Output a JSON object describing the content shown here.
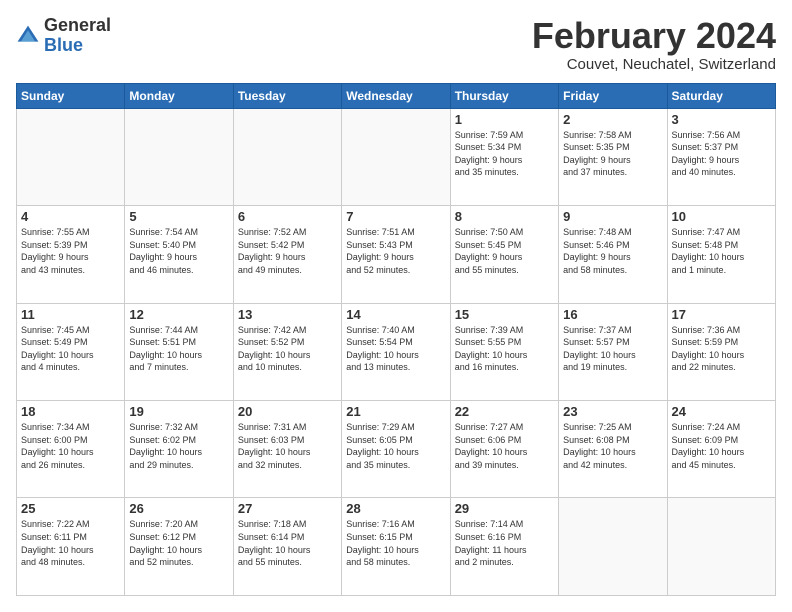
{
  "logo": {
    "general": "General",
    "blue": "Blue"
  },
  "title": "February 2024",
  "location": "Couvet, Neuchatel, Switzerland",
  "days_header": [
    "Sunday",
    "Monday",
    "Tuesday",
    "Wednesday",
    "Thursday",
    "Friday",
    "Saturday"
  ],
  "weeks": [
    [
      {
        "day": "",
        "info": ""
      },
      {
        "day": "",
        "info": ""
      },
      {
        "day": "",
        "info": ""
      },
      {
        "day": "",
        "info": ""
      },
      {
        "day": "1",
        "info": "Sunrise: 7:59 AM\nSunset: 5:34 PM\nDaylight: 9 hours\nand 35 minutes."
      },
      {
        "day": "2",
        "info": "Sunrise: 7:58 AM\nSunset: 5:35 PM\nDaylight: 9 hours\nand 37 minutes."
      },
      {
        "day": "3",
        "info": "Sunrise: 7:56 AM\nSunset: 5:37 PM\nDaylight: 9 hours\nand 40 minutes."
      }
    ],
    [
      {
        "day": "4",
        "info": "Sunrise: 7:55 AM\nSunset: 5:39 PM\nDaylight: 9 hours\nand 43 minutes."
      },
      {
        "day": "5",
        "info": "Sunrise: 7:54 AM\nSunset: 5:40 PM\nDaylight: 9 hours\nand 46 minutes."
      },
      {
        "day": "6",
        "info": "Sunrise: 7:52 AM\nSunset: 5:42 PM\nDaylight: 9 hours\nand 49 minutes."
      },
      {
        "day": "7",
        "info": "Sunrise: 7:51 AM\nSunset: 5:43 PM\nDaylight: 9 hours\nand 52 minutes."
      },
      {
        "day": "8",
        "info": "Sunrise: 7:50 AM\nSunset: 5:45 PM\nDaylight: 9 hours\nand 55 minutes."
      },
      {
        "day": "9",
        "info": "Sunrise: 7:48 AM\nSunset: 5:46 PM\nDaylight: 9 hours\nand 58 minutes."
      },
      {
        "day": "10",
        "info": "Sunrise: 7:47 AM\nSunset: 5:48 PM\nDaylight: 10 hours\nand 1 minute."
      }
    ],
    [
      {
        "day": "11",
        "info": "Sunrise: 7:45 AM\nSunset: 5:49 PM\nDaylight: 10 hours\nand 4 minutes."
      },
      {
        "day": "12",
        "info": "Sunrise: 7:44 AM\nSunset: 5:51 PM\nDaylight: 10 hours\nand 7 minutes."
      },
      {
        "day": "13",
        "info": "Sunrise: 7:42 AM\nSunset: 5:52 PM\nDaylight: 10 hours\nand 10 minutes."
      },
      {
        "day": "14",
        "info": "Sunrise: 7:40 AM\nSunset: 5:54 PM\nDaylight: 10 hours\nand 13 minutes."
      },
      {
        "day": "15",
        "info": "Sunrise: 7:39 AM\nSunset: 5:55 PM\nDaylight: 10 hours\nand 16 minutes."
      },
      {
        "day": "16",
        "info": "Sunrise: 7:37 AM\nSunset: 5:57 PM\nDaylight: 10 hours\nand 19 minutes."
      },
      {
        "day": "17",
        "info": "Sunrise: 7:36 AM\nSunset: 5:59 PM\nDaylight: 10 hours\nand 22 minutes."
      }
    ],
    [
      {
        "day": "18",
        "info": "Sunrise: 7:34 AM\nSunset: 6:00 PM\nDaylight: 10 hours\nand 26 minutes."
      },
      {
        "day": "19",
        "info": "Sunrise: 7:32 AM\nSunset: 6:02 PM\nDaylight: 10 hours\nand 29 minutes."
      },
      {
        "day": "20",
        "info": "Sunrise: 7:31 AM\nSunset: 6:03 PM\nDaylight: 10 hours\nand 32 minutes."
      },
      {
        "day": "21",
        "info": "Sunrise: 7:29 AM\nSunset: 6:05 PM\nDaylight: 10 hours\nand 35 minutes."
      },
      {
        "day": "22",
        "info": "Sunrise: 7:27 AM\nSunset: 6:06 PM\nDaylight: 10 hours\nand 39 minutes."
      },
      {
        "day": "23",
        "info": "Sunrise: 7:25 AM\nSunset: 6:08 PM\nDaylight: 10 hours\nand 42 minutes."
      },
      {
        "day": "24",
        "info": "Sunrise: 7:24 AM\nSunset: 6:09 PM\nDaylight: 10 hours\nand 45 minutes."
      }
    ],
    [
      {
        "day": "25",
        "info": "Sunrise: 7:22 AM\nSunset: 6:11 PM\nDaylight: 10 hours\nand 48 minutes."
      },
      {
        "day": "26",
        "info": "Sunrise: 7:20 AM\nSunset: 6:12 PM\nDaylight: 10 hours\nand 52 minutes."
      },
      {
        "day": "27",
        "info": "Sunrise: 7:18 AM\nSunset: 6:14 PM\nDaylight: 10 hours\nand 55 minutes."
      },
      {
        "day": "28",
        "info": "Sunrise: 7:16 AM\nSunset: 6:15 PM\nDaylight: 10 hours\nand 58 minutes."
      },
      {
        "day": "29",
        "info": "Sunrise: 7:14 AM\nSunset: 6:16 PM\nDaylight: 11 hours\nand 2 minutes."
      },
      {
        "day": "",
        "info": ""
      },
      {
        "day": "",
        "info": ""
      }
    ]
  ]
}
